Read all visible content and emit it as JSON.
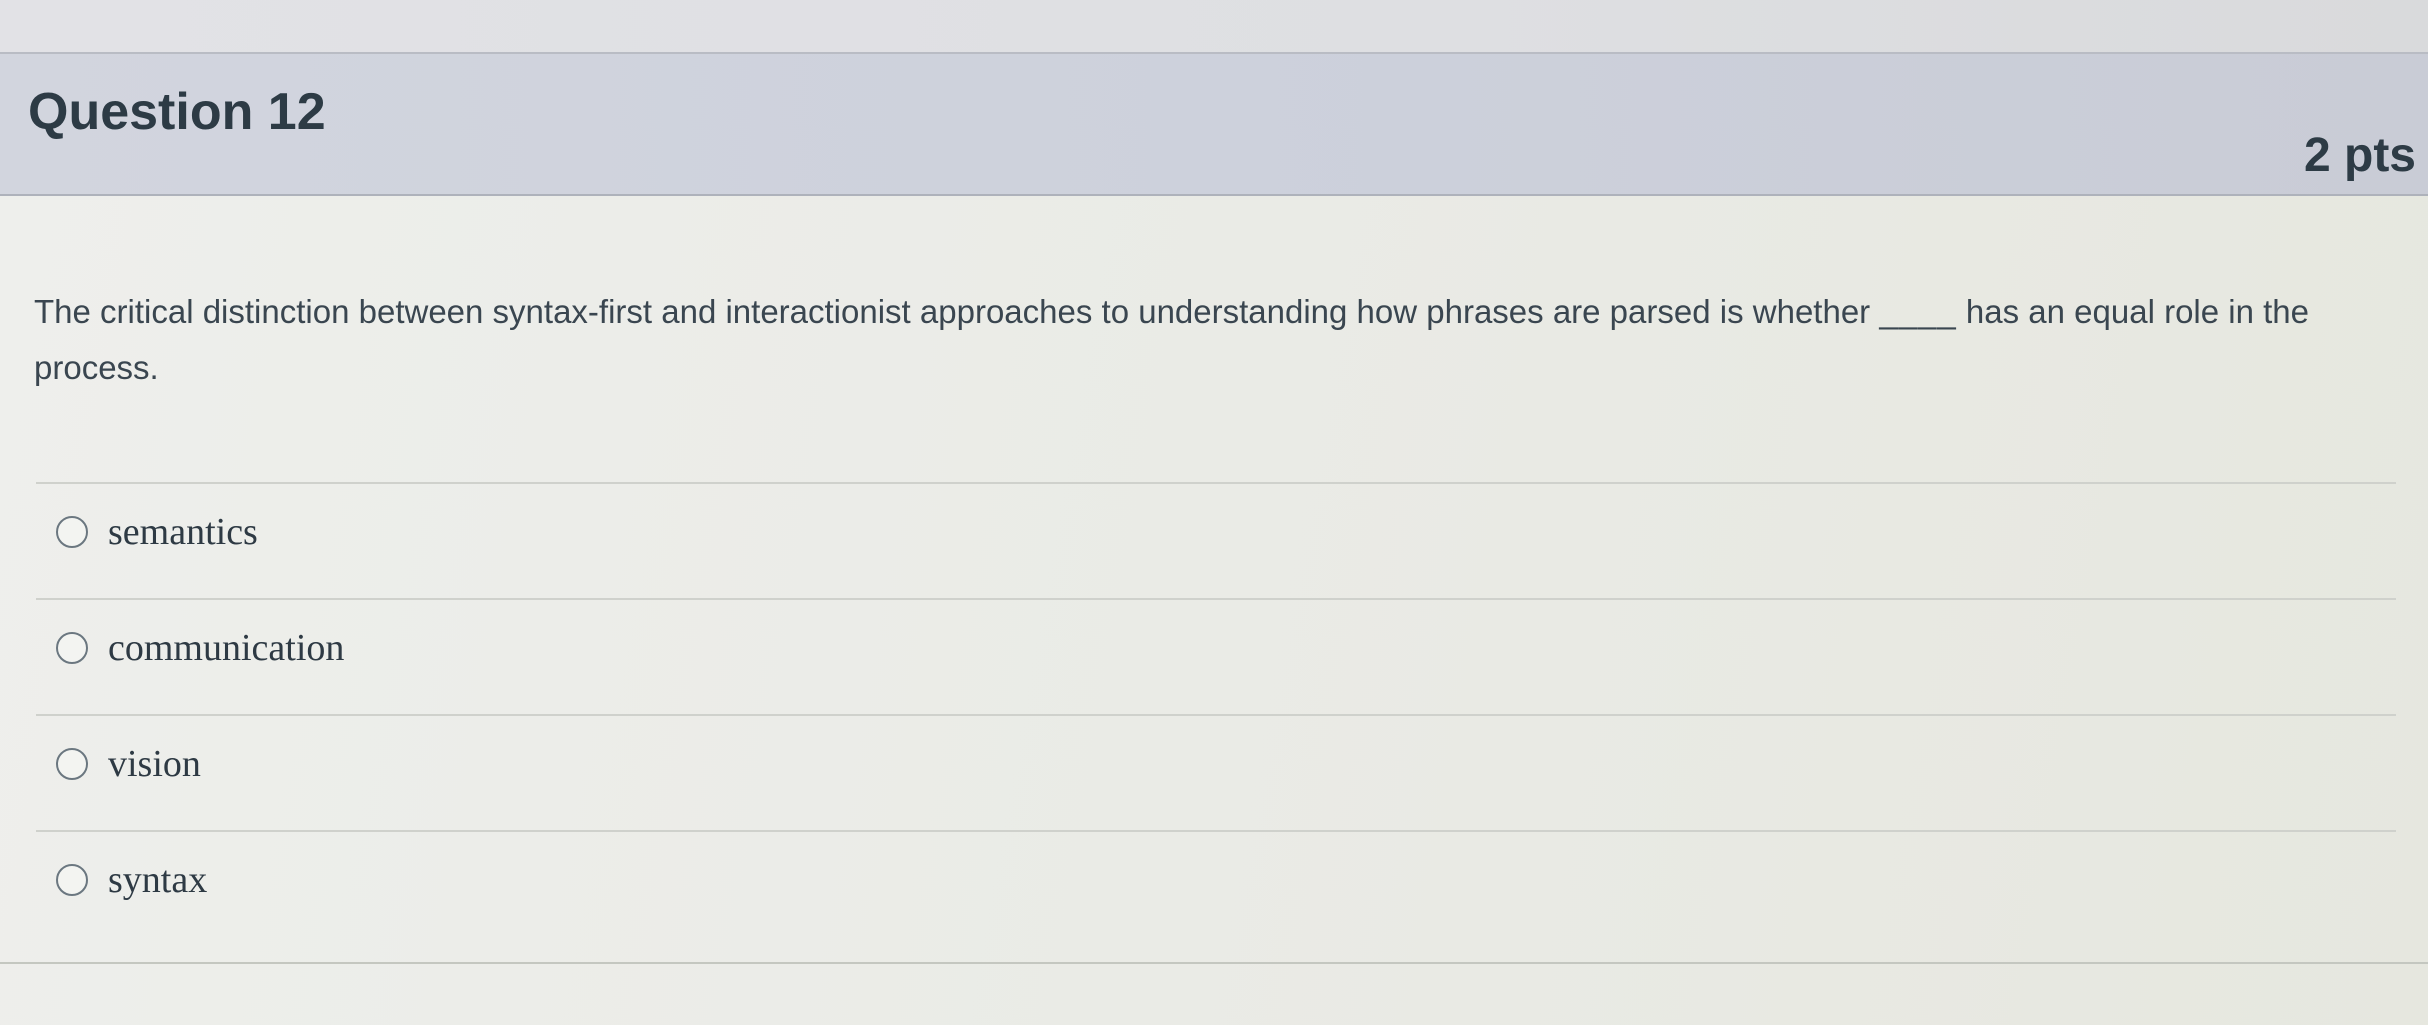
{
  "question": {
    "title": "Question 12",
    "points": "2 pts",
    "text_before_blank": "The critical distinction between syntax-first and interactionist approaches to understanding how phrases are parsed is whether ",
    "blank": "____",
    "text_after_blank": " has an equal role in the process."
  },
  "answers": [
    {
      "label": "semantics",
      "selected": false
    },
    {
      "label": "communication",
      "selected": false
    },
    {
      "label": "vision",
      "selected": false
    },
    {
      "label": "syntax",
      "selected": false
    }
  ]
}
